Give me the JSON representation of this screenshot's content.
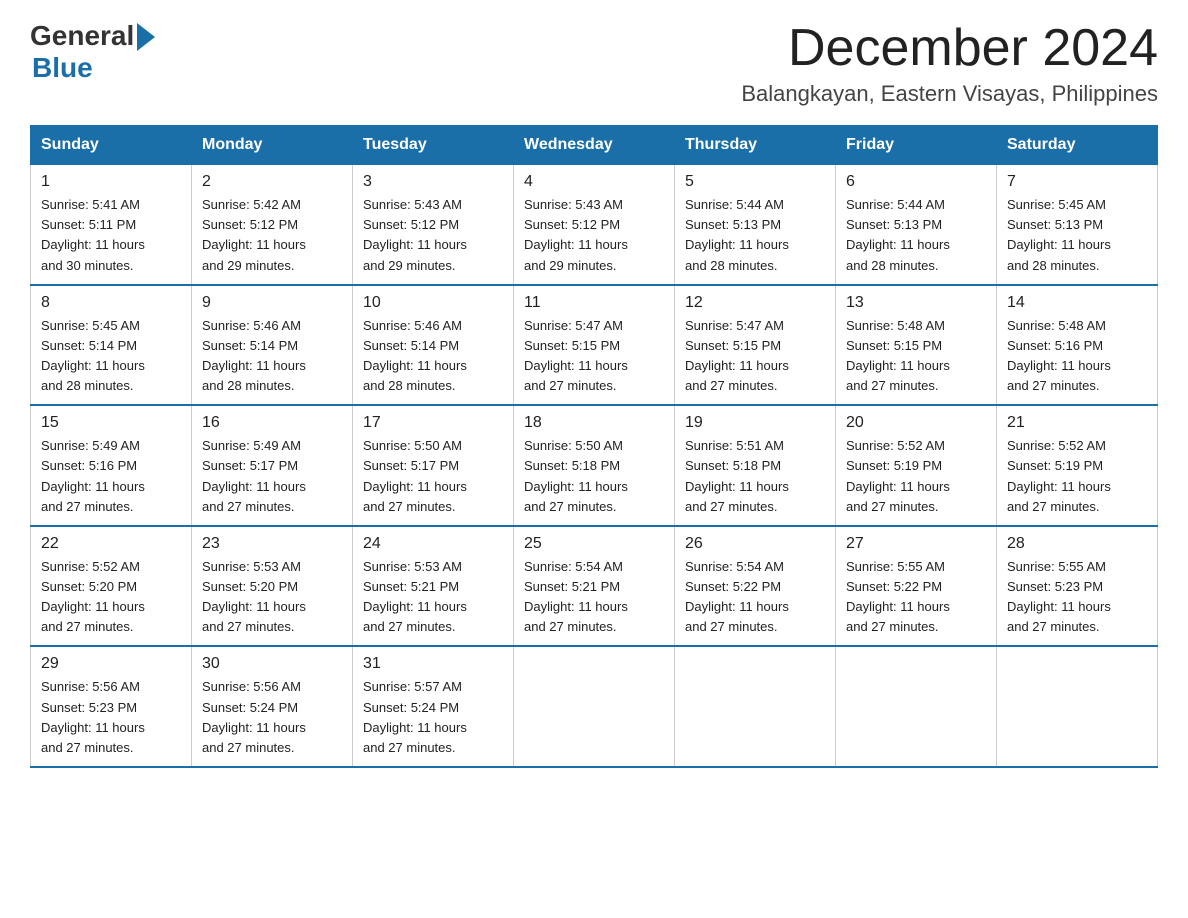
{
  "header": {
    "logo_general": "General",
    "logo_blue": "Blue",
    "month_title": "December 2024",
    "location": "Balangkayan, Eastern Visayas, Philippines"
  },
  "weekdays": [
    "Sunday",
    "Monday",
    "Tuesday",
    "Wednesday",
    "Thursday",
    "Friday",
    "Saturday"
  ],
  "weeks": [
    [
      {
        "day": "1",
        "sunrise": "5:41 AM",
        "sunset": "5:11 PM",
        "daylight": "11 hours and 30 minutes."
      },
      {
        "day": "2",
        "sunrise": "5:42 AM",
        "sunset": "5:12 PM",
        "daylight": "11 hours and 29 minutes."
      },
      {
        "day": "3",
        "sunrise": "5:43 AM",
        "sunset": "5:12 PM",
        "daylight": "11 hours and 29 minutes."
      },
      {
        "day": "4",
        "sunrise": "5:43 AM",
        "sunset": "5:12 PM",
        "daylight": "11 hours and 29 minutes."
      },
      {
        "day": "5",
        "sunrise": "5:44 AM",
        "sunset": "5:13 PM",
        "daylight": "11 hours and 28 minutes."
      },
      {
        "day": "6",
        "sunrise": "5:44 AM",
        "sunset": "5:13 PM",
        "daylight": "11 hours and 28 minutes."
      },
      {
        "day": "7",
        "sunrise": "5:45 AM",
        "sunset": "5:13 PM",
        "daylight": "11 hours and 28 minutes."
      }
    ],
    [
      {
        "day": "8",
        "sunrise": "5:45 AM",
        "sunset": "5:14 PM",
        "daylight": "11 hours and 28 minutes."
      },
      {
        "day": "9",
        "sunrise": "5:46 AM",
        "sunset": "5:14 PM",
        "daylight": "11 hours and 28 minutes."
      },
      {
        "day": "10",
        "sunrise": "5:46 AM",
        "sunset": "5:14 PM",
        "daylight": "11 hours and 28 minutes."
      },
      {
        "day": "11",
        "sunrise": "5:47 AM",
        "sunset": "5:15 PM",
        "daylight": "11 hours and 27 minutes."
      },
      {
        "day": "12",
        "sunrise": "5:47 AM",
        "sunset": "5:15 PM",
        "daylight": "11 hours and 27 minutes."
      },
      {
        "day": "13",
        "sunrise": "5:48 AM",
        "sunset": "5:15 PM",
        "daylight": "11 hours and 27 minutes."
      },
      {
        "day": "14",
        "sunrise": "5:48 AM",
        "sunset": "5:16 PM",
        "daylight": "11 hours and 27 minutes."
      }
    ],
    [
      {
        "day": "15",
        "sunrise": "5:49 AM",
        "sunset": "5:16 PM",
        "daylight": "11 hours and 27 minutes."
      },
      {
        "day": "16",
        "sunrise": "5:49 AM",
        "sunset": "5:17 PM",
        "daylight": "11 hours and 27 minutes."
      },
      {
        "day": "17",
        "sunrise": "5:50 AM",
        "sunset": "5:17 PM",
        "daylight": "11 hours and 27 minutes."
      },
      {
        "day": "18",
        "sunrise": "5:50 AM",
        "sunset": "5:18 PM",
        "daylight": "11 hours and 27 minutes."
      },
      {
        "day": "19",
        "sunrise": "5:51 AM",
        "sunset": "5:18 PM",
        "daylight": "11 hours and 27 minutes."
      },
      {
        "day": "20",
        "sunrise": "5:52 AM",
        "sunset": "5:19 PM",
        "daylight": "11 hours and 27 minutes."
      },
      {
        "day": "21",
        "sunrise": "5:52 AM",
        "sunset": "5:19 PM",
        "daylight": "11 hours and 27 minutes."
      }
    ],
    [
      {
        "day": "22",
        "sunrise": "5:52 AM",
        "sunset": "5:20 PM",
        "daylight": "11 hours and 27 minutes."
      },
      {
        "day": "23",
        "sunrise": "5:53 AM",
        "sunset": "5:20 PM",
        "daylight": "11 hours and 27 minutes."
      },
      {
        "day": "24",
        "sunrise": "5:53 AM",
        "sunset": "5:21 PM",
        "daylight": "11 hours and 27 minutes."
      },
      {
        "day": "25",
        "sunrise": "5:54 AM",
        "sunset": "5:21 PM",
        "daylight": "11 hours and 27 minutes."
      },
      {
        "day": "26",
        "sunrise": "5:54 AM",
        "sunset": "5:22 PM",
        "daylight": "11 hours and 27 minutes."
      },
      {
        "day": "27",
        "sunrise": "5:55 AM",
        "sunset": "5:22 PM",
        "daylight": "11 hours and 27 minutes."
      },
      {
        "day": "28",
        "sunrise": "5:55 AM",
        "sunset": "5:23 PM",
        "daylight": "11 hours and 27 minutes."
      }
    ],
    [
      {
        "day": "29",
        "sunrise": "5:56 AM",
        "sunset": "5:23 PM",
        "daylight": "11 hours and 27 minutes."
      },
      {
        "day": "30",
        "sunrise": "5:56 AM",
        "sunset": "5:24 PM",
        "daylight": "11 hours and 27 minutes."
      },
      {
        "day": "31",
        "sunrise": "5:57 AM",
        "sunset": "5:24 PM",
        "daylight": "11 hours and 27 minutes."
      },
      null,
      null,
      null,
      null
    ]
  ],
  "labels": {
    "sunrise": "Sunrise:",
    "sunset": "Sunset:",
    "daylight": "Daylight:"
  }
}
